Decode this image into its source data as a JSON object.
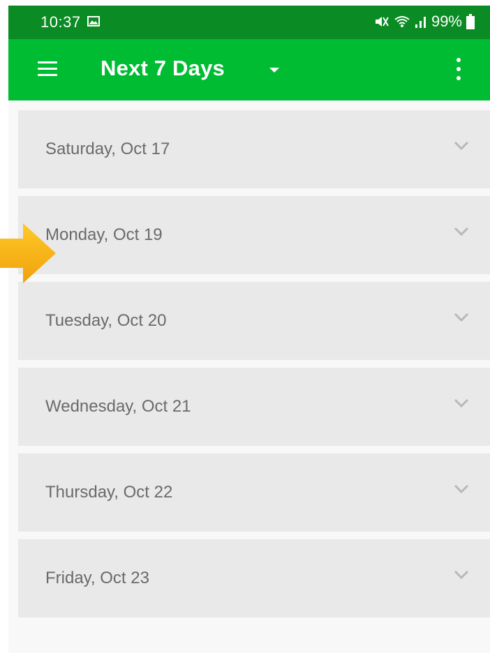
{
  "status_bar": {
    "time": "10:37",
    "battery": "99%",
    "icons": [
      "gallery-icon",
      "mute-icon",
      "wifi-icon",
      "signal-icon",
      "battery-icon"
    ]
  },
  "app_bar": {
    "title": "Next 7 Days",
    "icons": [
      "menu-icon",
      "dropdown-icon",
      "overflow-menu-icon"
    ]
  },
  "days": [
    {
      "label": "Saturday, Oct 17"
    },
    {
      "label": "Monday, Oct 19"
    },
    {
      "label": "Tuesday, Oct 20"
    },
    {
      "label": "Wednesday, Oct 21"
    },
    {
      "label": "Thursday, Oct 22"
    },
    {
      "label": "Friday, Oct 23"
    }
  ],
  "colors": {
    "status_bar": "#0b8b23",
    "app_bar": "#00bc32",
    "card": "#e9e9e9",
    "annotation_arrow": "#f5b417"
  }
}
